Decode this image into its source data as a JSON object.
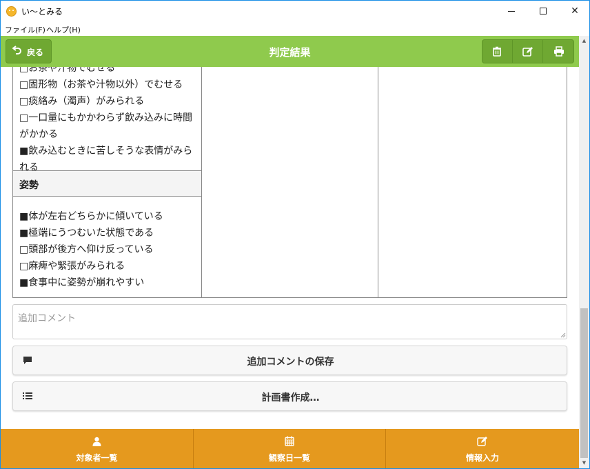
{
  "window": {
    "title": "い〜とみる"
  },
  "menu": {
    "file": "ファイル(F)",
    "help": "ヘルプ(H)"
  },
  "header": {
    "back_label": "戻る",
    "title": "判定結果"
  },
  "table": {
    "list_a": [
      "□お茶や汁物でむせる",
      "□固形物（お茶や汁物以外）でむせる",
      "□痰絡み（濁声）がみられる",
      "□一口量にもかかわらず飲み込みに時間がかかる",
      "■飲み込むときに苦しそうな表情がみられる"
    ],
    "section_title": "姿勢",
    "list_b": [
      "■体が左右どちらかに傾いている",
      "■極端にうつむいた状態である",
      "□頭部が後方へ仰け反っている",
      "□麻痺や緊張がみられる",
      "■食事中に姿勢が崩れやすい"
    ]
  },
  "comment": {
    "placeholder": "追加コメント"
  },
  "buttons": {
    "save_comment": "追加コメントの保存",
    "create_plan": "計画書作成…"
  },
  "bottom_nav": [
    {
      "label": "対象者一覧",
      "icon": "person-icon"
    },
    {
      "label": "観察日一覧",
      "icon": "calendar-icon"
    },
    {
      "label": "情報入力",
      "icon": "edit-icon"
    }
  ],
  "colors": {
    "header_green": "#8fca4d",
    "button_green": "#6fa832",
    "nav_orange": "#e5991e"
  }
}
